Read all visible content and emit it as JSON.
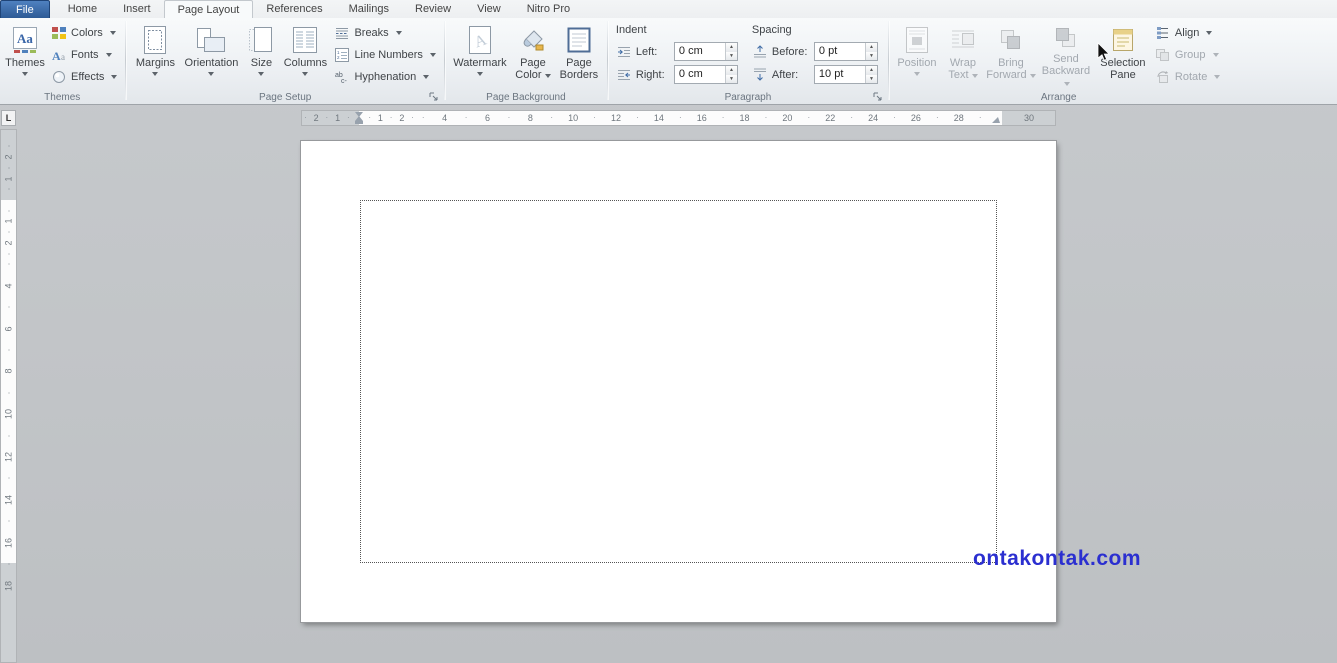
{
  "tabs": [
    {
      "label": "File"
    },
    {
      "label": "Home"
    },
    {
      "label": "Insert"
    },
    {
      "label": "Page Layout"
    },
    {
      "label": "References"
    },
    {
      "label": "Mailings"
    },
    {
      "label": "Review"
    },
    {
      "label": "View"
    },
    {
      "label": "Nitro Pro"
    }
  ],
  "active_tab": "Page Layout",
  "ribbon": {
    "themes": {
      "group_label": "Themes",
      "themes_button": "Themes",
      "colors": "Colors",
      "fonts": "Fonts",
      "effects": "Effects"
    },
    "page_setup": {
      "group_label": "Page Setup",
      "margins": "Margins",
      "orientation": "Orientation",
      "size": "Size",
      "columns": "Columns",
      "breaks": "Breaks",
      "line_numbers": "Line Numbers",
      "hyphenation": "Hyphenation"
    },
    "page_background": {
      "group_label": "Page Background",
      "watermark": "Watermark",
      "page_color": "Page Color",
      "page_borders": "Page Borders"
    },
    "paragraph": {
      "group_label": "Paragraph",
      "indent_heading": "Indent",
      "spacing_heading": "Spacing",
      "left_label": "Left:",
      "right_label": "Right:",
      "before_label": "Before:",
      "after_label": "After:",
      "left_value": "0 cm",
      "right_value": "0 cm",
      "before_value": "0 pt",
      "after_value": "10 pt"
    },
    "arrange": {
      "group_label": "Arrange",
      "position": "Position",
      "wrap_text": "Wrap Text",
      "bring_forward": "Bring Forward",
      "send_backward": "Send Backward",
      "selection_pane": "Selection Pane",
      "align": "Align",
      "group": "Group",
      "rotate": "Rotate"
    }
  },
  "ruler": {
    "tab_selector": "L",
    "h_gray_left": [
      "2",
      "1"
    ],
    "h_white": [
      "1",
      "2",
      "4",
      "6",
      "8",
      "10",
      "12",
      "14",
      "16",
      "18",
      "20",
      "22",
      "24",
      "26",
      "28"
    ],
    "h_gray_right": [
      "30"
    ],
    "v_gray_top": [
      "2",
      "1"
    ],
    "v_white": [
      "1",
      "2",
      "4",
      "6",
      "8",
      "10",
      "12",
      "14",
      "16"
    ],
    "v_gray_bottom": [
      "18"
    ]
  },
  "icons": {
    "spin_up": "▲",
    "spin_down": "▼"
  },
  "document": {
    "watermark_text": "ontakontak.com",
    "watermark_color": "#2b2fd0"
  }
}
